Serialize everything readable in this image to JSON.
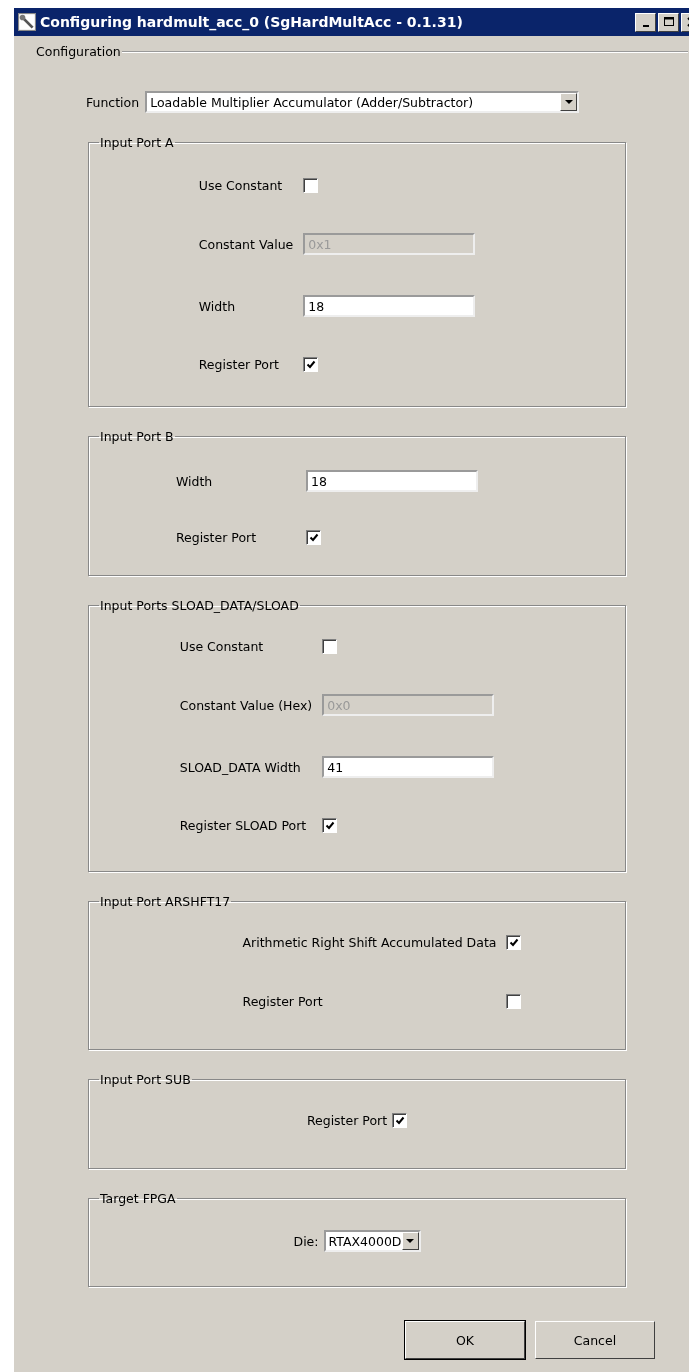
{
  "window": {
    "title": "Configuring hardmult_acc_0 (SgHardMultAcc - 0.1.31)"
  },
  "section": {
    "title": "Configuration"
  },
  "function": {
    "label": "Function",
    "value": "Loadable Multiplier Accumulator (Adder/Subtractor)"
  },
  "groups": [
    {
      "title": "Input Port A",
      "rows": [
        {
          "kind": "checkbox",
          "label": "Use Constant",
          "checked": false
        },
        {
          "kind": "field",
          "label": "Constant Value",
          "value": "0x1",
          "disabled": true
        },
        {
          "kind": "field",
          "label": "Width",
          "value": "18",
          "disabled": false
        },
        {
          "kind": "checkbox",
          "label": "Register Port",
          "checked": true
        }
      ]
    },
    {
      "title": "Input Port B",
      "rows": [
        {
          "kind": "field",
          "label": "Width",
          "value": "18",
          "disabled": false
        },
        {
          "kind": "checkbox",
          "label": "Register Port",
          "checked": true
        }
      ]
    },
    {
      "title": "Input Ports SLOAD_DATA/SLOAD",
      "rows": [
        {
          "kind": "checkbox",
          "label": "Use Constant",
          "checked": false
        },
        {
          "kind": "field",
          "label": "Constant Value (Hex)",
          "value": "0x0",
          "disabled": true
        },
        {
          "kind": "field",
          "label": "SLOAD_DATA Width",
          "value": "41",
          "disabled": false
        },
        {
          "kind": "checkbox",
          "label": "Register SLOAD Port",
          "checked": true
        }
      ]
    },
    {
      "title": "Input Port ARSHFT17",
      "rows": [
        {
          "kind": "checkbox",
          "label": "Arithmetic Right Shift Accumulated Data",
          "checked": true
        },
        {
          "kind": "checkbox",
          "label": "Register Port",
          "checked": false
        }
      ]
    },
    {
      "title": "Input Port SUB",
      "rows": [
        {
          "kind": "checkbox",
          "label": "Register Port",
          "checked": true
        }
      ]
    },
    {
      "title": "Target FPGA",
      "rows": [
        {
          "kind": "select",
          "label": "Die:",
          "value": "RTAX4000D"
        }
      ]
    }
  ],
  "buttons": [
    "OK",
    "Cancel"
  ]
}
